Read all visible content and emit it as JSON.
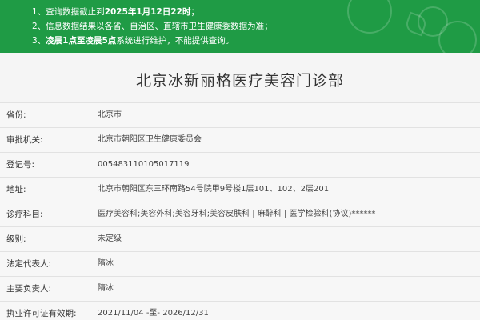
{
  "notice": {
    "line1_prefix": "1、查询数据截止到",
    "line1_date": "2025年1月12日22时",
    "line1_suffix": "；",
    "line2": "2、信息数据结果以各省、自治区、直辖市卫生健康委数据为准；",
    "line3_prefix": "3、",
    "line3_bold": "凌晨1点至凌晨5点",
    "line3_suffix": "系统进行维护，不能提供查询。",
    "background_color": "#1f9b45"
  },
  "title": "北京冰新丽格医疗美容门诊部",
  "rows": [
    {
      "label": "省份:",
      "value": "北京市"
    },
    {
      "label": "审批机关:",
      "value": "北京市朝阳区卫生健康委员会"
    },
    {
      "label": "登记号:",
      "value": "005483110105017119"
    },
    {
      "label": "地址:",
      "value": "北京市朝阳区东三环南路54号院甲9号楼1层101、102、2层201"
    },
    {
      "label": "诊疗科目:",
      "value": "医疗美容科;美容外科;美容牙科;美容皮肤科 | 麻醉科 | 医学检验科(协议)******"
    },
    {
      "label": "级别:",
      "value": "未定级"
    },
    {
      "label": "法定代表人:",
      "value": "隋冰"
    },
    {
      "label": "主要负责人:",
      "value": "隋冰"
    },
    {
      "label": "执业许可证有效期:",
      "value": "2021/11/04 -至- 2026/12/31"
    }
  ]
}
